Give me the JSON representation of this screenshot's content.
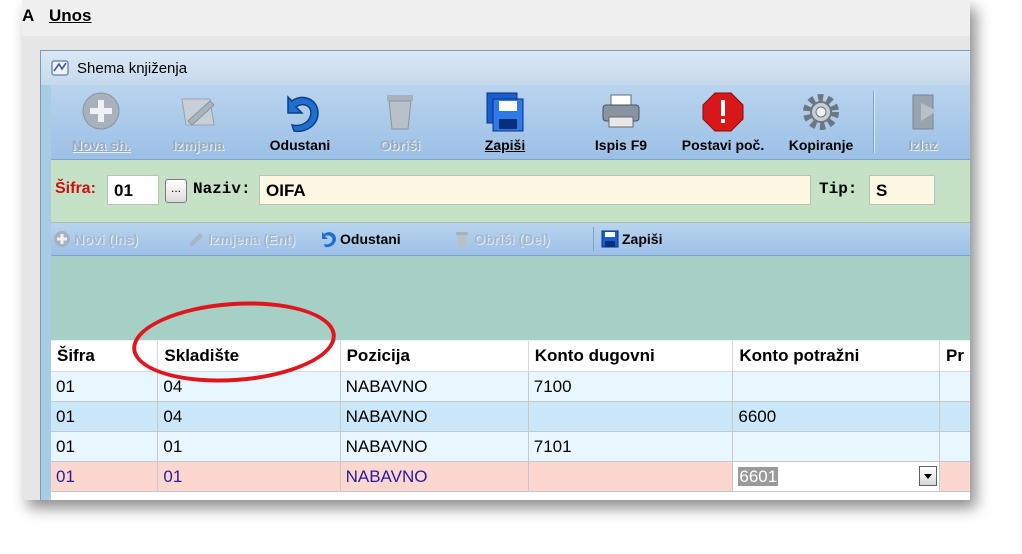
{
  "menubar": {
    "item_a": "A",
    "item_unos": "Unos"
  },
  "window": {
    "title": "Shema knjiženja"
  },
  "toolbar": {
    "new": "Nova sh.",
    "edit": "Izmjena",
    "cancel": "Odustani",
    "delete": "Obriši",
    "save": "Zapiši",
    "print": "Ispis F9",
    "initial": "Postavi poč.",
    "copy": "Kopiranje",
    "exit": "Izlaz"
  },
  "form": {
    "sifra_label": "Šifra:",
    "sifra_value": "01",
    "dots_label": "...",
    "naziv_label": "Naziv:",
    "naziv_value": "OIFA",
    "tip_label": "Tip:",
    "tip_value": "S"
  },
  "subtoolbar": {
    "new": "Novi (Ins)",
    "edit": "Izmjena (Ent)",
    "cancel": "Odustani",
    "delete": "Obriši (Del)",
    "save": "Zapiši"
  },
  "grid": {
    "columns": [
      "Šifra",
      "Skladište",
      "Pozicija",
      "Konto dugovni",
      "Konto potražni",
      "Pr"
    ],
    "rows": [
      [
        "01",
        "04",
        "NABAVNO",
        "7100",
        "",
        ""
      ],
      [
        "01",
        "04",
        "NABAVNO",
        "",
        "6600",
        ""
      ],
      [
        "01",
        "01",
        "NABAVNO",
        "7101",
        "",
        ""
      ],
      [
        "01",
        "01",
        "NABAVNO",
        "",
        "6601",
        ""
      ]
    ]
  },
  "colors": {
    "annotation_circle": "#e0161e",
    "toolbar_bg": "#a8cce4",
    "form_panel": "#c6e2c6",
    "teal_panel": "#a6cfc5",
    "selected_row": "#fcd7cf"
  }
}
